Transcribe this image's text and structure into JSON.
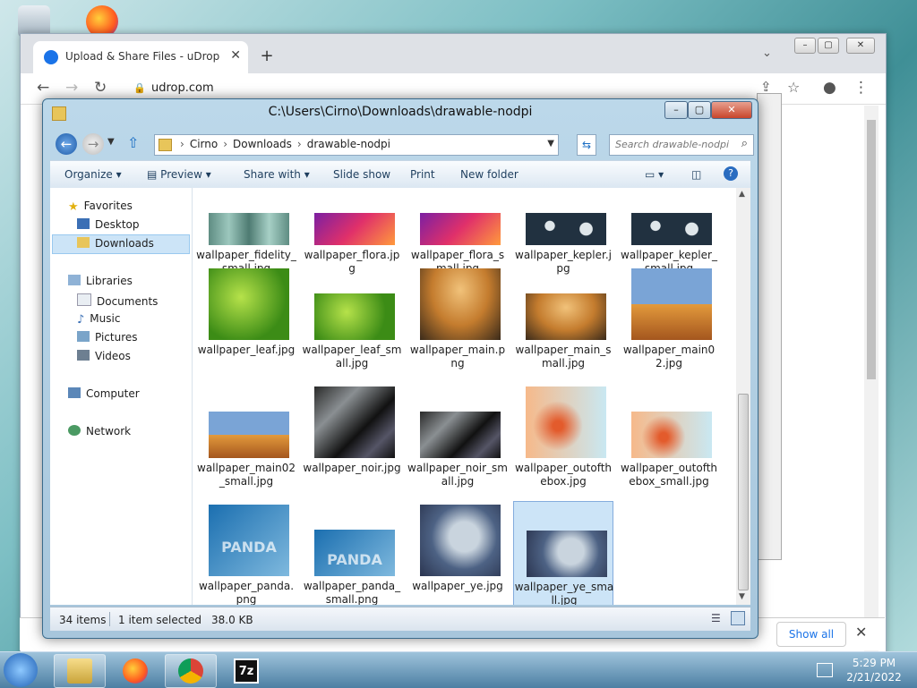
{
  "colors": {
    "selection": "#cce4f7",
    "chrome_accent": "#1a73e8"
  },
  "chrome": {
    "tab_title": "Upload & Share Files - uDrop",
    "tab_close": "✕",
    "new_tab": "+",
    "url": "udrop.com",
    "download_bar": {
      "show_all": "Show all",
      "close": "✕"
    }
  },
  "explorer": {
    "title": "C:\\Users\\Cirno\\Downloads\\drawable-nodpi",
    "breadcrumbs": [
      "Cirno",
      "Downloads",
      "drawable-nodpi"
    ],
    "search_placeholder": "Search drawable-nodpi",
    "commands": {
      "organize": "Organize",
      "preview": "Preview",
      "share_with": "Share with",
      "slide_show": "Slide show",
      "print": "Print",
      "new_folder": "New folder"
    },
    "nav": {
      "favorites": "Favorites",
      "desktop": "Desktop",
      "downloads": "Downloads",
      "libraries": "Libraries",
      "documents": "Documents",
      "music": "Music",
      "pictures": "Pictures",
      "videos": "Videos",
      "computer": "Computer",
      "network": "Network"
    },
    "files": [
      {
        "name": "wallpaper_fidelity_small.jpg",
        "thumb": "fidelity"
      },
      {
        "name": "wallpaper_flora.jpg",
        "thumb": "flora"
      },
      {
        "name": "wallpaper_flora_small.jpg",
        "thumb": "flora"
      },
      {
        "name": "wallpaper_kepler.jpg",
        "thumb": "kepler"
      },
      {
        "name": "wallpaper_kepler_small.jpg",
        "thumb": "kepler"
      },
      {
        "name": "wallpaper_leaf.jpg",
        "thumb": "leaf"
      },
      {
        "name": "wallpaper_leaf_small.jpg",
        "thumb": "leaf"
      },
      {
        "name": "wallpaper_main.png",
        "thumb": "main"
      },
      {
        "name": "wallpaper_main_small.jpg",
        "thumb": "main"
      },
      {
        "name": "wallpaper_main02.jpg",
        "thumb": "main02"
      },
      {
        "name": "wallpaper_main02_small.jpg",
        "thumb": "main02"
      },
      {
        "name": "wallpaper_noir.jpg",
        "thumb": "noir"
      },
      {
        "name": "wallpaper_noir_small.jpg",
        "thumb": "noir"
      },
      {
        "name": "wallpaper_outofthebox.jpg",
        "thumb": "outofthebox"
      },
      {
        "name": "wallpaper_outofthebox_small.jpg",
        "thumb": "outofthebox"
      },
      {
        "name": "wallpaper_panda.png",
        "thumb": "panda",
        "text": "PANDA"
      },
      {
        "name": "wallpaper_panda_small.png",
        "thumb": "panda",
        "text": "PANDA"
      },
      {
        "name": "wallpaper_ye.jpg",
        "thumb": "ye"
      },
      {
        "name": "wallpaper_ye_small.jpg",
        "thumb": "ye",
        "selected": true
      }
    ],
    "status": {
      "count": "34 items",
      "selected": "1 item selected",
      "size": "38.0 KB"
    }
  },
  "taskbar": {
    "clock_time": "5:29 PM",
    "clock_date": "2/21/2022",
    "app_7zip": "7z"
  }
}
